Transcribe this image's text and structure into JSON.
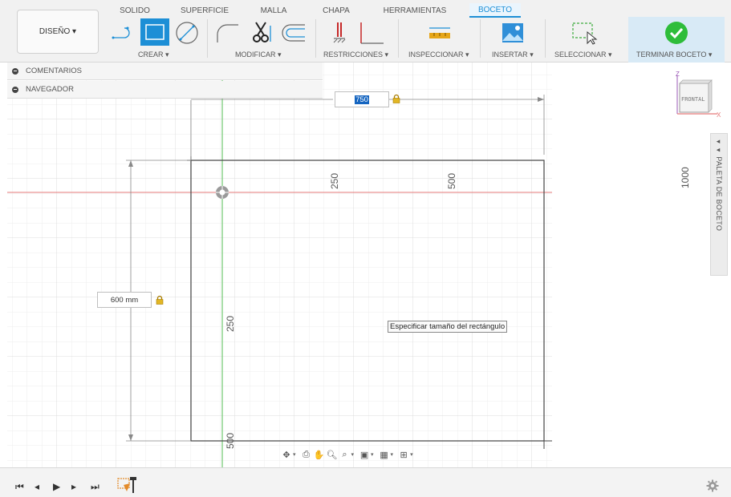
{
  "toolbar": {
    "workspace_label": "DISEÑO",
    "tabs": [
      "SOLIDO",
      "SUPERFICIE",
      "MALLA",
      "CHAPA",
      "HERRAMIENTAS",
      "BOCETO"
    ],
    "active_tab": "BOCETO",
    "groups": {
      "crear": "CREAR",
      "modificar": "MODIFICAR",
      "restricciones": "RESTRICCIONES",
      "inspeccionar": "INSPECCIONAR",
      "insertar": "INSERTAR",
      "seleccionar": "SELECCIONAR",
      "terminar": "TERMINAR BOCETO"
    },
    "accent_color": "#1d8fd6"
  },
  "panels": {
    "comments": "COMENTARIOS",
    "navigator": "NAVEGADOR"
  },
  "canvas": {
    "width_input": "750",
    "height_input": "600 mm",
    "tooltip": "Especificar tamaño del rectángulo",
    "rulers": {
      "top_250": "250",
      "top_500": "500",
      "top_750": "750",
      "top_1000": "1000",
      "left_250": "250",
      "left_500": "500"
    }
  },
  "viewcube": {
    "face": "FRONTAL",
    "axis_z": "Z",
    "axis_x": "X"
  },
  "palette": {
    "label": "PALETA DE BOCETO"
  },
  "icons": [
    "orbit-icon",
    "look-at-icon",
    "pan-icon",
    "zoom-icon",
    "fit-icon",
    "display-icon",
    "grid-icon",
    "viewports-icon",
    "gear-icon",
    "lock-icon",
    "checkmark-icon"
  ]
}
